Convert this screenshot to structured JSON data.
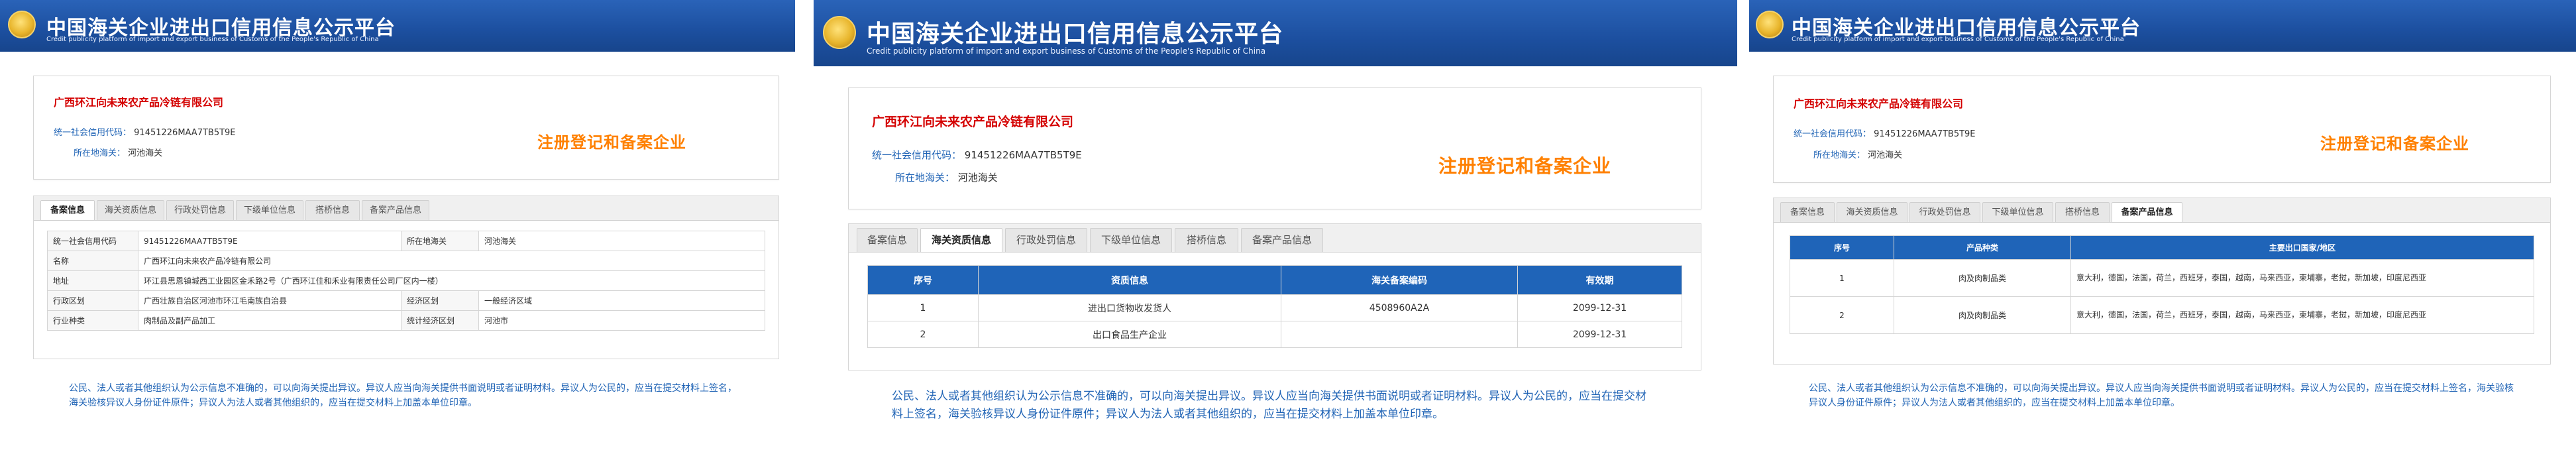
{
  "header": {
    "title": "中国海关企业进出口信用信息公示平台",
    "subtitle": "Credit publicity platform of import and export business of Customs of the People's Republic of China"
  },
  "company": {
    "name": "广西环江向未来农产品冷链有限公司",
    "credit_code_label": "统一社会信用代码：",
    "credit_code": "91451226MAA7TB5T9E",
    "customs_label": "所在地海关：",
    "customs": "河池海关",
    "stamp": "注册登记和备案企业"
  },
  "tabs": [
    "备案信息",
    "海关资质信息",
    "行政处罚信息",
    "下级单位信息",
    "搭桥信息",
    "备案产品信息"
  ],
  "basic_info": {
    "rows": [
      [
        "统一社会信用代码",
        "91451226MAA7TB5T9E",
        "所在地海关",
        "河池海关"
      ],
      [
        "名称",
        "广西环江向未来农产品冷链有限公司",
        "",
        ""
      ],
      [
        "地址",
        "环江县思恩镇城西工业园区金禾路2号（广西环江佳和禾业有限责任公司厂区内一楼）",
        "",
        ""
      ],
      [
        "行政区划",
        "广西壮族自治区河池市环江毛南族自治县",
        "经济区划",
        "一般经济区域"
      ],
      [
        "行业种类",
        "肉制品及副产品加工",
        "统计经济区划",
        "河池市"
      ]
    ]
  },
  "qualification": {
    "columns": [
      "序号",
      "资质信息",
      "海关备案编码",
      "有效期"
    ],
    "rows": [
      [
        "1",
        "进出口货物收发货人",
        "4508960A2A",
        "2099-12-31"
      ],
      [
        "2",
        "出口食品生产企业",
        "",
        "2099-12-31"
      ]
    ]
  },
  "products": {
    "columns": [
      "序号",
      "产品种类",
      "主要出口国家/地区"
    ],
    "rows": [
      [
        "1",
        "肉及肉制品类",
        "意大利，德国，法国，荷兰，西班牙，泰国，越南，马来西亚，柬埔寨，老挝，新加坡，印度尼西亚"
      ],
      [
        "2",
        "肉及肉制品类",
        "意大利，德国，法国，荷兰，西班牙，泰国，越南，马来西亚，柬埔寨，老挝，新加坡，印度尼西亚"
      ]
    ]
  },
  "notice": "公民、法人或者其他组织认为公示信息不准确的，可以向海关提出异议。异议人应当向海关提供书面说明或者证明材料。异议人为公民的，应当在提交材料上签名，海关验核异议人身份证件原件；异议人为法人或者其他组织的，应当在提交材料上加盖本单位印章。",
  "colors": {
    "header_blue": "#1c4f9f",
    "company_red": "#d40000",
    "label_blue": "#1f63b5",
    "stamp_orange": "#ff8000",
    "table_header_blue": "#1f64b8"
  }
}
